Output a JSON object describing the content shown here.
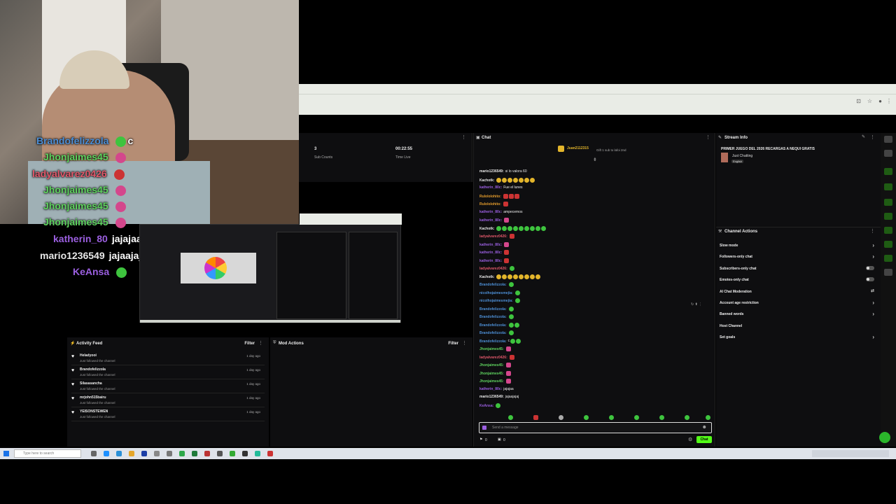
{
  "overlay_chat": [
    {
      "name": "Brandofelizzola",
      "color": "#4d8fd6",
      "msg": "",
      "emote": "c"
    },
    {
      "name": "Jhonjaimes45",
      "color": "#5fd35f",
      "msg": ""
    },
    {
      "name": "ladyalvarez0426",
      "color": "#e0586a",
      "msg": ""
    },
    {
      "name": "Jhonjaimes45",
      "color": "#5fd35f",
      "msg": ""
    },
    {
      "name": "Jhonjaimes45",
      "color": "#5fd35f",
      "msg": ""
    },
    {
      "name": "Jhonjaimes45",
      "color": "#5fd35f",
      "msg": ""
    },
    {
      "name": "katherin_80",
      "color": "#9b5fe0",
      "msg": "jajajaa"
    },
    {
      "name": "mario1236549",
      "color": "#e8e8e8",
      "msg": "jajaajajaj"
    },
    {
      "name": "KeAnsa",
      "color": "#9b5fe0",
      "msg": ""
    }
  ],
  "stats": {
    "sub_count_value": "3",
    "sub_count_label": "Sub Counts",
    "time_live_value": "00:22:55",
    "time_live_label": "Time Live"
  },
  "activity": {
    "title": "Activity Feed",
    "filter": "Filter",
    "items": [
      {
        "name": "Heladyooi",
        "sub": "Just followed the channel",
        "time": "1 day ago"
      },
      {
        "name": "Brandofelizzola",
        "sub": "Just followed the channel",
        "time": "1 day ago"
      },
      {
        "name": "Silasasancha",
        "sub": "Just followed the channel",
        "time": "1 day ago"
      },
      {
        "name": "mrjohn515bairu",
        "sub": "Just followed the channel",
        "time": "1 day ago"
      },
      {
        "name": "YEISONSTEWEN",
        "sub": "Just followed the channel",
        "time": "1 day ago"
      }
    ]
  },
  "mod": {
    "title": "Mod Actions",
    "filter": "Filter"
  },
  "chat": {
    "title": "Chat",
    "pinned_user": "Juan2112315",
    "pinned_text": "Gift 1 sub to lafoi 2nd",
    "placeholder": "Send a message",
    "send": "Chat",
    "viewer_count": "0",
    "points": "0",
    "lines": [
      {
        "name": "mario1236549:",
        "color": "#e8e8e8",
        "msg": "si lo valora 60",
        "emotes": []
      },
      {
        "name": "Kachotk:",
        "color": "#e8e8e8",
        "msg": "",
        "emotes": [
          "gold",
          "gold",
          "gold",
          "gold",
          "gold",
          "gold",
          "gold"
        ]
      },
      {
        "name": "katherin_80c:",
        "color": "#9b5fe0",
        "msg": "Fue el lunes",
        "emotes": []
      },
      {
        "name": "Rulololohito:",
        "color": "#e39b2c",
        "msg": "",
        "emotes": [
          "red",
          "red",
          "red"
        ]
      },
      {
        "name": "Rulololohito:",
        "color": "#e39b2c",
        "msg": "",
        "emotes": [
          "red"
        ]
      },
      {
        "name": "katherin_80c:",
        "color": "#9b5fe0",
        "msg": "ampecemos",
        "emotes": []
      },
      {
        "name": "katherin_80c:",
        "color": "#9b5fe0",
        "msg": "",
        "emotes": [
          "pink"
        ]
      },
      {
        "name": "Kachotk:",
        "color": "#e8e8e8",
        "msg": "",
        "emotes": [
          "gem",
          "gem",
          "gem",
          "gem",
          "gem",
          "gem",
          "gem",
          "gem",
          "gem"
        ]
      },
      {
        "name": "ladyalvarez0426:",
        "color": "#e0586a",
        "msg": "",
        "emotes": [
          "red"
        ]
      },
      {
        "name": "katherin_80c:",
        "color": "#9b5fe0",
        "msg": "",
        "emotes": [
          "pink"
        ]
      },
      {
        "name": "katherin_80c:",
        "color": "#9b5fe0",
        "msg": "",
        "emotes": [
          "red"
        ]
      },
      {
        "name": "katherin_80c:",
        "color": "#9b5fe0",
        "msg": "",
        "emotes": [
          "red"
        ]
      },
      {
        "name": "ladyalvarez0426:",
        "color": "#e0586a",
        "msg": "",
        "emotes": [
          "gem"
        ]
      },
      {
        "name": "Kachotk:",
        "color": "#e8e8e8",
        "msg": "",
        "emotes": [
          "gold",
          "gold",
          "gold",
          "gold",
          "gold",
          "gold",
          "gold",
          "gold"
        ]
      },
      {
        "name": "Brandofelizzola:",
        "color": "#4d8fd6",
        "msg": "",
        "emotes": [
          "gem"
        ]
      },
      {
        "name": "nicolhojaimesmejia:",
        "color": "#4d8fd6",
        "msg": "",
        "emotes": [
          "gem"
        ]
      },
      {
        "name": "nicolhojaimesmejia:",
        "color": "#4d8fd6",
        "msg": "",
        "emotes": [
          "gem"
        ]
      },
      {
        "name": "Brandofelizzola:",
        "color": "#4d8fd6",
        "msg": "",
        "emotes": [
          "gem"
        ]
      },
      {
        "name": "Brandofelizzola:",
        "color": "#4d8fd6",
        "msg": "",
        "emotes": [
          "gem"
        ]
      },
      {
        "name": "Brandofelizzola:",
        "color": "#4d8fd6",
        "msg": "",
        "emotes": [
          "gem",
          "gem"
        ]
      },
      {
        "name": "Brandofelizzola:",
        "color": "#4d8fd6",
        "msg": "",
        "emotes": [
          "gem"
        ]
      },
      {
        "name": "Brandofelizzola:",
        "color": "#4d8fd6",
        "msg": "c",
        "emotes": [
          "gem",
          "gem"
        ]
      },
      {
        "name": "Jhonjaimes45:",
        "color": "#5fd35f",
        "msg": "",
        "emotes": [
          "pink"
        ]
      },
      {
        "name": "ladyalvarez0426:",
        "color": "#e0586a",
        "msg": "",
        "emotes": [
          "red"
        ]
      },
      {
        "name": "Jhonjaimes45:",
        "color": "#5fd35f",
        "msg": "",
        "emotes": [
          "pink"
        ]
      },
      {
        "name": "Jhonjaimes45:",
        "color": "#5fd35f",
        "msg": "",
        "emotes": [
          "pink"
        ]
      },
      {
        "name": "Jhonjaimes45:",
        "color": "#5fd35f",
        "msg": "",
        "emotes": [
          "pink"
        ]
      },
      {
        "name": "katherin_80c:",
        "color": "#9b5fe0",
        "msg": "jajajaa",
        "emotes": []
      },
      {
        "name": "mario1236549:",
        "color": "#e8e8e8",
        "msg": "jajaajajaj",
        "emotes": []
      },
      {
        "name": "KeAnsa:",
        "color": "#9b5fe0",
        "msg": "",
        "emotes": [
          "gem"
        ]
      }
    ]
  },
  "stream_info": {
    "title": "Stream Info",
    "stream_title": "PRIMER JUEGO DEL 2026 RECARGAS A NEQUI GRATIS",
    "category": "Just Chatting",
    "language": "English"
  },
  "channel_actions": {
    "title": "Channel Actions",
    "items": [
      {
        "label": "Slow mode",
        "control": "arrow"
      },
      {
        "label": "Followers-only chat",
        "control": "arrow"
      },
      {
        "label": "Subscribers-only chat",
        "control": "toggle"
      },
      {
        "label": "Emotes-only chat",
        "control": "toggle"
      },
      {
        "label": "AI Chat Moderation",
        "control": "icon"
      },
      {
        "label": "Account age restriction",
        "control": "arrow"
      },
      {
        "label": "Banned words",
        "control": "arrow"
      },
      {
        "label": "Host Channel",
        "control": "none"
      },
      {
        "label": "Set goals",
        "control": "arrow"
      }
    ]
  },
  "taskbar": {
    "search_placeholder": "Type here to search"
  },
  "colors": {
    "accent": "#53fc18",
    "panel": "#0e0e10"
  }
}
